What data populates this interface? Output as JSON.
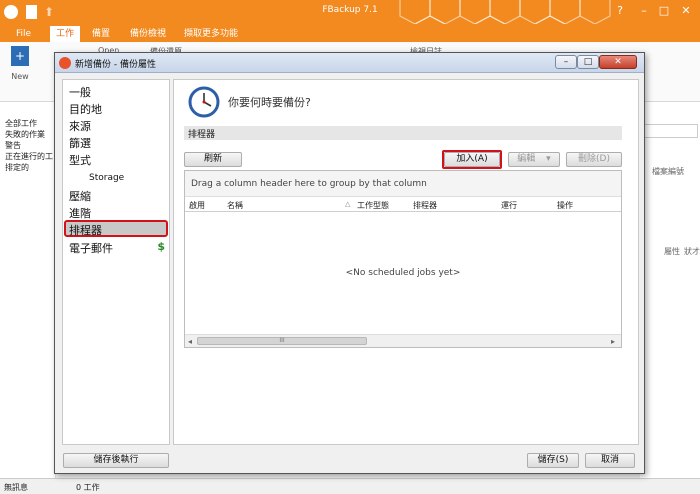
{
  "app": {
    "title": "FBackup 7.1",
    "colors": {
      "accent": "#f28a1f",
      "highlight": "#d2121a"
    }
  },
  "ribbon": {
    "tabs": [
      "File",
      "工作",
      "備置",
      "備份檢視",
      "擷取更多功能"
    ],
    "active_tab": 1,
    "new_label": "New",
    "partial_labels": [
      "Open",
      "備份還原",
      "檢視日誌"
    ]
  },
  "left_list": {
    "items": [
      "全部工作",
      "失敗的作業",
      "警告",
      "正在進行的工",
      "排定的"
    ]
  },
  "right_panel": {
    "column_label": "檔案編號",
    "labels": [
      "屬性",
      "狀才"
    ]
  },
  "status": {
    "left": "無訊息",
    "count": "0 工作"
  },
  "dialog": {
    "title": "新增備份 - 備份屬性",
    "nav": {
      "items": [
        "一般",
        "目的地",
        "來源",
        "篩選",
        "型式",
        "Storage",
        "壓縮",
        "進階",
        "排程器",
        "電子郵件"
      ],
      "selected": "排程器",
      "dollar_icon": "$"
    },
    "content": {
      "question": "你要何時要備份?",
      "section_title": "排程器",
      "refresh_button": "刷新",
      "add_button": "加入(A)",
      "edit_button": "編輯",
      "delete_button": "刪除(D)",
      "group_hint": "Drag a column header here to group by that column",
      "columns": [
        "啟用",
        "名稱",
        "工作型態",
        "排程器",
        "運行",
        "操作"
      ],
      "empty_message": "<No scheduled jobs yet>",
      "scroll_thumb_mark": "III"
    },
    "footer": {
      "save_run_button": "儲存後執行",
      "save_button": "儲存(S)",
      "cancel_button": "取消"
    }
  }
}
